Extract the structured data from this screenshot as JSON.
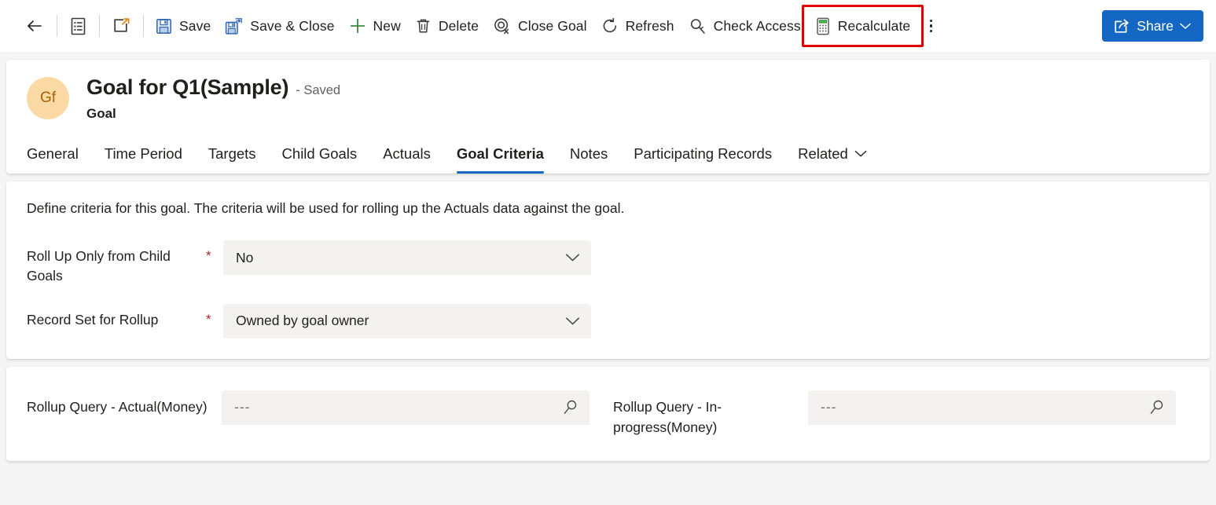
{
  "commandbar": {
    "items": [
      {
        "name": "back",
        "icon": "back-arrow-icon",
        "label": ""
      },
      {
        "name": "form-selector",
        "icon": "form-icon",
        "label": ""
      },
      {
        "name": "popout",
        "icon": "pop-out-icon",
        "label": ""
      },
      {
        "name": "save",
        "icon": "save-icon",
        "label": "Save"
      },
      {
        "name": "save-and-close",
        "icon": "save-and-close-icon",
        "label": "Save & Close"
      },
      {
        "name": "new",
        "icon": "plus-icon",
        "label": "New"
      },
      {
        "name": "delete",
        "icon": "trash-icon",
        "label": "Delete"
      },
      {
        "name": "close-goal",
        "icon": "close-goal-icon",
        "label": "Close Goal"
      },
      {
        "name": "refresh",
        "icon": "refresh-icon",
        "label": "Refresh"
      },
      {
        "name": "check-access",
        "icon": "key-icon",
        "label": "Check Access"
      },
      {
        "name": "recalculate",
        "icon": "calculator-icon",
        "label": "Recalculate"
      }
    ],
    "overflow_label": "More commands",
    "share_label": "Share",
    "highlight_color": "#e00000",
    "share_color": "#1567c4"
  },
  "record": {
    "avatar_initials": "Gf",
    "avatar_bg": "#fbd9a5",
    "avatar_fg": "#a4620b",
    "title": "Goal for Q1(Sample)",
    "status": "- Saved",
    "entity": "Goal"
  },
  "tabs": {
    "items": [
      {
        "label": "General",
        "active": false
      },
      {
        "label": "Time Period",
        "active": false
      },
      {
        "label": "Targets",
        "active": false
      },
      {
        "label": "Child Goals",
        "active": false
      },
      {
        "label": "Actuals",
        "active": false
      },
      {
        "label": "Goal Criteria",
        "active": true
      },
      {
        "label": "Notes",
        "active": false
      },
      {
        "label": "Participating Records",
        "active": false
      }
    ],
    "related_label": "Related",
    "active_underline_color": "#1567c4"
  },
  "criteria": {
    "description": "Define criteria for this goal. The criteria will be used for rolling up the Actuals data against the goal.",
    "fields": [
      {
        "label": "Roll Up Only from Child Goals",
        "required": "*",
        "value": "No",
        "type": "select"
      },
      {
        "label": "Record Set for Rollup",
        "required": "*",
        "value": "Owned by goal owner",
        "type": "select"
      }
    ]
  },
  "rollup": {
    "fields": [
      {
        "label": "Rollup Query - Actual(Money)",
        "value": "---",
        "type": "lookup"
      },
      {
        "label": "Rollup Query - In-progress(Money)",
        "value": "---",
        "type": "lookup"
      }
    ]
  }
}
